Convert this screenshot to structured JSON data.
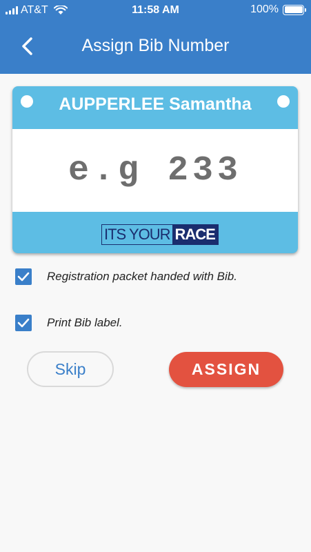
{
  "status_bar": {
    "carrier": "AT&T",
    "time": "11:58 AM",
    "battery": "100%",
    "icons": [
      "signal-icon",
      "wifi-icon",
      "battery-icon"
    ]
  },
  "nav": {
    "title": "Assign Bib Number",
    "back_icon": "chevron-left-icon"
  },
  "bib": {
    "runner_name": "AUPPERLEE Samantha",
    "number_placeholder": "e.g 233",
    "number_value": "",
    "logo": {
      "text_light": "ITS YOUR",
      "text_bold": "RACE"
    }
  },
  "options": [
    {
      "label": "Registration packet handed with Bib.",
      "checked": true
    },
    {
      "label": "Print Bib label.",
      "checked": true
    }
  ],
  "actions": {
    "skip_label": "Skip",
    "assign_label": "ASSIGN"
  },
  "colors": {
    "header": "#3a7fc9",
    "bib_blue": "#5dbde4",
    "checkbox": "#3a7fc9",
    "assign_button": "#e35240",
    "logo_navy": "#1a2d6e"
  }
}
